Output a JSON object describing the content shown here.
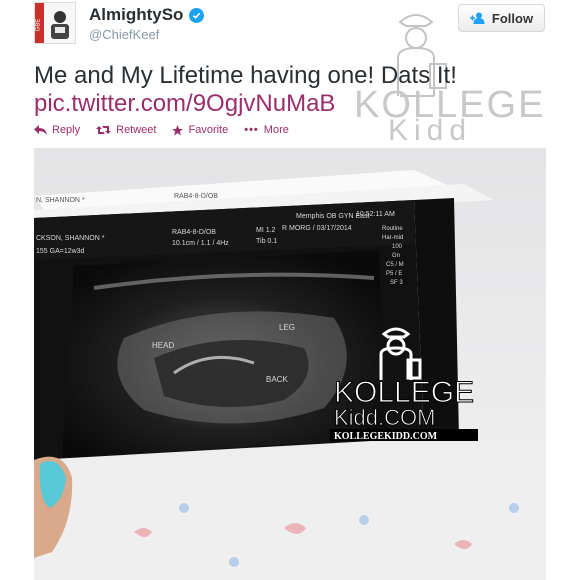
{
  "tweet": {
    "avatar_icon": "user-avatar-icon",
    "display_name": "AlmightySo",
    "handle": "@ChiefKeef",
    "verified_icon": "verified-badge-icon",
    "follow_label": "Follow",
    "text": "Me and My Lifetime having one! Dats It!",
    "link": "pic.twitter.com/9OgjvNuMaB",
    "actions": {
      "reply": "Reply",
      "retweet": "Retweet",
      "favorite": "Favorite",
      "more": "More"
    },
    "accent_color": "#9c2d6c"
  },
  "watermark": {
    "line1": "KOLLEGE",
    "line2": "Kidd",
    "line1_photo": "KOLLEGE",
    "line2_photo": "Kidd.COM",
    "url": "KOLLEGEKIDD.COM"
  },
  "ultrasound": {
    "patient_1": "N, SHANNON *",
    "patient_2": "CKSON, SHANNON *",
    "ga": "155 GA=12w3d",
    "probe": "RAB4-8-D/OB",
    "probe_2": "RAB4-8-D/OB",
    "mi": "MI 1.2",
    "tib": "Tib 0.1",
    "settings": "10.1cm / 1.1 / 4Hz",
    "clinic": "Memphis OB GYN East",
    "date": "R MORG / 03/17/2014",
    "time": "10:52:11 AM",
    "routine": "Routine",
    "har": "Har-mid",
    "v100": "100",
    "gn": "Gn",
    "c5": "C5 / M",
    "p5": "P5 / E",
    "sf": "SF 3",
    "label_head": "HEAD",
    "label_leg": "LEG",
    "label_back": "BACK"
  }
}
